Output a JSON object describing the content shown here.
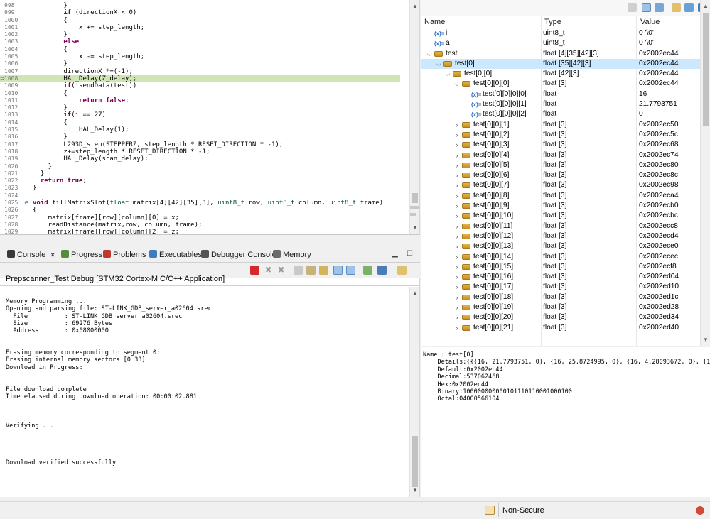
{
  "editor": {
    "lines": [
      {
        "no": "998",
        "code": "        }"
      },
      {
        "no": "999",
        "code": "        if (directionX < 0)"
      },
      {
        "no": "1000",
        "code": "        {"
      },
      {
        "no": "1001",
        "code": "            x += step_length;"
      },
      {
        "no": "1002",
        "code": "        }"
      },
      {
        "no": "1003",
        "code": "        else"
      },
      {
        "no": "1004",
        "code": "        {"
      },
      {
        "no": "1005",
        "code": "            x -= step_length;"
      },
      {
        "no": "1006",
        "code": "        }"
      },
      {
        "no": "1007",
        "code": "        directionX *=(-1);"
      },
      {
        "no": "1008",
        "code": "        HAL_Delay(Z_delay);"
      },
      {
        "no": "1009",
        "code": "        if(!sendData(test))"
      },
      {
        "no": "1010",
        "code": "        {"
      },
      {
        "no": "1011",
        "code": "            return false;"
      },
      {
        "no": "1012",
        "code": "        }"
      },
      {
        "no": "1013",
        "code": "        if(i == 27)"
      },
      {
        "no": "1014",
        "code": "        {"
      },
      {
        "no": "1015",
        "code": "            HAL_Delay(1);"
      },
      {
        "no": "1016",
        "code": "        }"
      },
      {
        "no": "1017",
        "code": "        L293D_step(STEPPERZ, step_length * RESET_DIRECTION * -1);"
      },
      {
        "no": "1018",
        "code": "        z+=step_length * RESET_DIRECTION * -1;"
      },
      {
        "no": "1019",
        "code": "        HAL_Delay(scan_delay);"
      },
      {
        "no": "1020",
        "code": "    }"
      },
      {
        "no": "1021",
        "code": "  }"
      },
      {
        "no": "1022",
        "code": "  return true;"
      },
      {
        "no": "1023",
        "code": "}"
      },
      {
        "no": "1024",
        "code": ""
      },
      {
        "no": "1025",
        "code": "void fillMatrixSlot(float matrix[4][42][35][3], uint8_t row, uint8_t column, uint8_t frame)"
      },
      {
        "no": "1026",
        "code": "{"
      },
      {
        "no": "1027",
        "code": "    matrix[frame][row][column][0] = x;"
      },
      {
        "no": "1028",
        "code": "    readDistance(matrix,row, column, frame);"
      },
      {
        "no": "1029",
        "code": "    matrix[frame][row][column][2] = z;"
      }
    ],
    "highlight_line": "1008",
    "fold_marker": "⊖",
    "current_marker": "⇒"
  },
  "console": {
    "tabs": [
      {
        "label": "Console",
        "icon": "console-icon",
        "color": "#3a3a3a"
      },
      {
        "label": "Progress",
        "icon": "progress-icon",
        "color": "#4f8f3a"
      },
      {
        "label": "Problems",
        "icon": "problems-icon",
        "color": "#c0392b"
      },
      {
        "label": "Executables",
        "icon": "executables-icon",
        "color": "#3e7cc2"
      },
      {
        "label": "Debugger Console",
        "icon": "debugger-console-icon",
        "color": "#555555"
      },
      {
        "label": "Memory",
        "icon": "memory-icon",
        "color": "#6a6a6a"
      }
    ],
    "tab_close": "✕",
    "title": "Prepscanner_Test Debug [STM32 Cortex-M C/C++ Application]",
    "output": [
      "Memory Programming ...",
      "Opening and parsing file: ST-LINK_GDB_server_a02604.srec",
      "  File          : ST-LINK_GDB_server_a02604.srec",
      "  Size          : 69276 Bytes",
      "  Address       : 0x08000000",
      "",
      "",
      "Erasing memory corresponding to segment 0:",
      "Erasing internal memory sectors [0 33]",
      "Download in Progress:",
      "",
      "",
      "File download complete",
      "Time elapsed during download operation: 00:00:02.881",
      "",
      "",
      "",
      "Verifying ...",
      "",
      "",
      "",
      "",
      "Download verified successfully"
    ]
  },
  "variables": {
    "headers": {
      "name": "Name",
      "type": "Type",
      "value": "Value"
    },
    "rows": [
      {
        "depth": 0,
        "twisty": "",
        "icon": "var",
        "name": "i",
        "type": "uint8_t",
        "value": "0 '\\0'"
      },
      {
        "depth": 0,
        "twisty": "",
        "icon": "var",
        "name": "a",
        "type": "uint8_t",
        "value": "0 '\\0'"
      },
      {
        "depth": 0,
        "twisty": "v",
        "icon": "arr",
        "name": "test",
        "type": "float [4][35][42][3]",
        "value": "0x2002ec44"
      },
      {
        "depth": 1,
        "twisty": "v",
        "icon": "arr",
        "name": "test[0]",
        "type": "float [35][42][3]",
        "value": "0x2002ec44",
        "selected": true
      },
      {
        "depth": 2,
        "twisty": "v",
        "icon": "arr",
        "name": "test[0][0]",
        "type": "float [42][3]",
        "value": "0x2002ec44"
      },
      {
        "depth": 3,
        "twisty": "v",
        "icon": "arr",
        "name": "test[0][0][0]",
        "type": "float [3]",
        "value": "0x2002ec44"
      },
      {
        "depth": 4,
        "twisty": "",
        "icon": "var",
        "name": "test[0][0][0][0]",
        "type": "float",
        "value": "16"
      },
      {
        "depth": 4,
        "twisty": "",
        "icon": "var",
        "name": "test[0][0][0][1]",
        "type": "float",
        "value": "21.7793751"
      },
      {
        "depth": 4,
        "twisty": "",
        "icon": "var",
        "name": "test[0][0][0][2]",
        "type": "float",
        "value": "0"
      },
      {
        "depth": 3,
        "twisty": ">",
        "icon": "arr",
        "name": "test[0][0][1]",
        "type": "float [3]",
        "value": "0x2002ec50"
      },
      {
        "depth": 3,
        "twisty": ">",
        "icon": "arr",
        "name": "test[0][0][2]",
        "type": "float [3]",
        "value": "0x2002ec5c"
      },
      {
        "depth": 3,
        "twisty": ">",
        "icon": "arr",
        "name": "test[0][0][3]",
        "type": "float [3]",
        "value": "0x2002ec68"
      },
      {
        "depth": 3,
        "twisty": ">",
        "icon": "arr",
        "name": "test[0][0][4]",
        "type": "float [3]",
        "value": "0x2002ec74"
      },
      {
        "depth": 3,
        "twisty": ">",
        "icon": "arr",
        "name": "test[0][0][5]",
        "type": "float [3]",
        "value": "0x2002ec80"
      },
      {
        "depth": 3,
        "twisty": ">",
        "icon": "arr",
        "name": "test[0][0][6]",
        "type": "float [3]",
        "value": "0x2002ec8c"
      },
      {
        "depth": 3,
        "twisty": ">",
        "icon": "arr",
        "name": "test[0][0][7]",
        "type": "float [3]",
        "value": "0x2002ec98"
      },
      {
        "depth": 3,
        "twisty": ">",
        "icon": "arr",
        "name": "test[0][0][8]",
        "type": "float [3]",
        "value": "0x2002eca4"
      },
      {
        "depth": 3,
        "twisty": ">",
        "icon": "arr",
        "name": "test[0][0][9]",
        "type": "float [3]",
        "value": "0x2002ecb0"
      },
      {
        "depth": 3,
        "twisty": ">",
        "icon": "arr",
        "name": "test[0][0][10]",
        "type": "float [3]",
        "value": "0x2002ecbc"
      },
      {
        "depth": 3,
        "twisty": ">",
        "icon": "arr",
        "name": "test[0][0][11]",
        "type": "float [3]",
        "value": "0x2002ecc8"
      },
      {
        "depth": 3,
        "twisty": ">",
        "icon": "arr",
        "name": "test[0][0][12]",
        "type": "float [3]",
        "value": "0x2002ecd4"
      },
      {
        "depth": 3,
        "twisty": ">",
        "icon": "arr",
        "name": "test[0][0][13]",
        "type": "float [3]",
        "value": "0x2002ece0"
      },
      {
        "depth": 3,
        "twisty": ">",
        "icon": "arr",
        "name": "test[0][0][14]",
        "type": "float [3]",
        "value": "0x2002ecec"
      },
      {
        "depth": 3,
        "twisty": ">",
        "icon": "arr",
        "name": "test[0][0][15]",
        "type": "float [3]",
        "value": "0x2002ecf8"
      },
      {
        "depth": 3,
        "twisty": ">",
        "icon": "arr",
        "name": "test[0][0][16]",
        "type": "float [3]",
        "value": "0x2002ed04"
      },
      {
        "depth": 3,
        "twisty": ">",
        "icon": "arr",
        "name": "test[0][0][17]",
        "type": "float [3]",
        "value": "0x2002ed10"
      },
      {
        "depth": 3,
        "twisty": ">",
        "icon": "arr",
        "name": "test[0][0][18]",
        "type": "float [3]",
        "value": "0x2002ed1c"
      },
      {
        "depth": 3,
        "twisty": ">",
        "icon": "arr",
        "name": "test[0][0][19]",
        "type": "float [3]",
        "value": "0x2002ed28"
      },
      {
        "depth": 3,
        "twisty": ">",
        "icon": "arr",
        "name": "test[0][0][20]",
        "type": "float [3]",
        "value": "0x2002ed34"
      },
      {
        "depth": 3,
        "twisty": ">",
        "icon": "arr",
        "name": "test[0][0][21]",
        "type": "float [3]",
        "value": "0x2002ed40"
      }
    ],
    "var_icon_text": "(x)="
  },
  "details": {
    "lines": [
      "Name : test[0]",
      "    Details:{{{16, 21.7793751, 0}, {16, 25.8724995, 0}, {16, 4.28093672, 0}, {16,",
      "    Default:0x2002ec44",
      "    Decimal:537062468",
      "    Hex:0x2002ec44",
      "    Binary:100000000000101110110001000100",
      "    Octal:04000566104"
    ]
  },
  "status": {
    "security": "Non-Secure"
  },
  "colors": {
    "highlight": "#cfe5b4",
    "selection": "#cce8ff",
    "keyword": "#7f0055",
    "type": "#005032"
  }
}
